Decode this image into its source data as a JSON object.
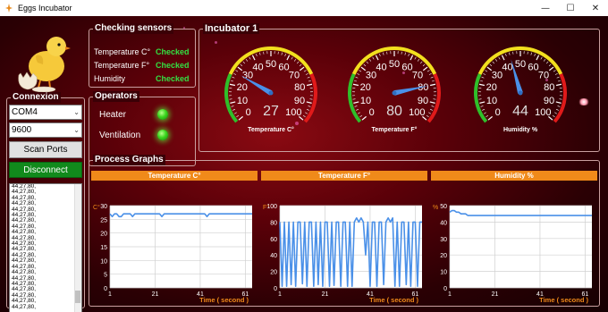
{
  "window": {
    "title": "Eggs Incubator",
    "minimize": "—",
    "maximize": "☐",
    "close": "✕"
  },
  "checking_sensors": {
    "title": "Checking sensors",
    "rows": [
      {
        "label": "Temperature C°",
        "status": "Checked"
      },
      {
        "label": "Temperature F°",
        "status": "Checked"
      },
      {
        "label": "Humidity",
        "status": "Checked"
      }
    ]
  },
  "operators": {
    "title": "Operators",
    "items": [
      {
        "label": "Heater",
        "state": "on"
      },
      {
        "label": "Ventilation",
        "state": "on"
      }
    ]
  },
  "connexion": {
    "title": "Connexion",
    "port": "COM4",
    "baud": "9600",
    "scan_label": "Scan Ports",
    "disconnect_label": "Disconnect",
    "log_lines": [
      "44,27,80,",
      "44,27,80,",
      "44,27,80,",
      "44,27,80,",
      "44,27,80,",
      "44,27,80,",
      "44,27,80,",
      "44,27,80,",
      "44,27,80,",
      "44,27,80,",
      "44,27,80,",
      "44,27,80,",
      "44,27,80,",
      "44,27,80,",
      "44,27,80,",
      "44,27,80,",
      "44,27,80,",
      "44,27,80,",
      "44,27,80,",
      "44,27,80,",
      "44,27,80,",
      "44,27,80,"
    ]
  },
  "incubator": {
    "title": "Incubator 1",
    "gauges": [
      {
        "label": "Temperature C°",
        "value": "27",
        "reading": 27,
        "min": 0,
        "max": 100,
        "ticks": [
          "0",
          "10",
          "20",
          "30",
          "40",
          "50",
          "60",
          "70",
          "80",
          "90",
          "100"
        ]
      },
      {
        "label": "Temperature F°",
        "value": "80",
        "reading": 80,
        "min": 0,
        "max": 100,
        "ticks": [
          "0",
          "10",
          "20",
          "30",
          "40",
          "50",
          "60",
          "70",
          "80",
          "90",
          "100"
        ]
      },
      {
        "label": "Humidity %",
        "value": "44",
        "reading": 44,
        "min": 0,
        "max": 100,
        "ticks": [
          "0",
          "10",
          "20",
          "30",
          "40",
          "50",
          "60",
          "70",
          "80",
          "90",
          "100"
        ]
      }
    ]
  },
  "process_graphs": {
    "title": "Process Graphs"
  },
  "colors": {
    "accent_orange": "#f08a1a",
    "line_blue": "#4a90e8",
    "ok_green": "#33e043"
  },
  "chart_data": [
    {
      "type": "line",
      "title": "Temperature C°",
      "ylabel": "C°",
      "xlabel": "Time ( second )",
      "x_ticks": [
        "1",
        "21",
        "41",
        "61"
      ],
      "y_ticks": [
        "0",
        "5",
        "10",
        "15",
        "20",
        "25",
        "30"
      ],
      "xlim": [
        1,
        64
      ],
      "ylim": [
        0,
        30
      ],
      "grid": true,
      "series": [
        {
          "values": [
            27,
            26,
            27,
            27,
            26,
            26,
            27,
            27,
            27,
            27,
            26,
            27,
            27,
            27,
            27,
            27,
            27,
            27,
            27,
            27,
            27,
            27,
            27,
            26,
            27,
            27,
            27,
            27,
            27,
            27,
            27,
            27,
            27,
            27,
            27,
            27,
            27,
            27,
            27,
            27,
            27,
            27,
            27,
            26,
            27,
            27,
            27,
            27,
            27,
            27,
            27,
            27,
            27,
            27,
            27,
            27,
            27,
            27,
            27,
            27,
            27,
            27,
            27,
            27
          ]
        }
      ]
    },
    {
      "type": "line",
      "title": "Temperature F°",
      "ylabel": "F°",
      "xlabel": "Time ( second )",
      "x_ticks": [
        "1",
        "21",
        "41",
        "61"
      ],
      "y_ticks": [
        "0",
        "20",
        "40",
        "60",
        "80",
        "100"
      ],
      "xlim": [
        1,
        64
      ],
      "ylim": [
        0,
        100
      ],
      "grid": true,
      "series": [
        {
          "values": [
            80,
            2,
            80,
            2,
            80,
            4,
            80,
            2,
            80,
            80,
            5,
            80,
            2,
            80,
            80,
            2,
            80,
            4,
            80,
            2,
            80,
            80,
            2,
            80,
            3,
            80,
            80,
            2,
            80,
            80,
            2,
            80,
            2,
            80,
            85,
            80,
            85,
            80,
            40,
            80,
            2,
            80,
            80,
            2,
            80,
            80,
            4,
            80,
            85,
            80,
            85,
            2,
            80,
            2,
            80,
            80,
            4,
            80,
            2,
            80,
            80,
            2,
            80,
            80
          ]
        }
      ]
    },
    {
      "type": "line",
      "title": "Humidity %",
      "ylabel": "%",
      "xlabel": "Time ( second )",
      "x_ticks": [
        "1",
        "21",
        "41",
        "61"
      ],
      "y_ticks": [
        "0",
        "10",
        "20",
        "30",
        "40",
        "50"
      ],
      "xlim": [
        1,
        64
      ],
      "ylim": [
        0,
        50
      ],
      "grid": true,
      "series": [
        {
          "values": [
            46,
            47,
            47,
            46,
            46,
            45,
            45,
            45,
            44,
            44,
            44,
            44,
            44,
            44,
            44,
            44,
            44,
            44,
            44,
            44,
            44,
            44,
            44,
            44,
            44,
            44,
            44,
            44,
            44,
            44,
            44,
            44,
            44,
            44,
            44,
            44,
            44,
            44,
            44,
            44,
            44,
            44,
            44,
            44,
            44,
            44,
            44,
            44,
            44,
            44,
            44,
            44,
            44,
            44,
            44,
            44,
            44,
            44,
            44,
            44,
            44,
            44,
            44,
            44
          ]
        }
      ]
    }
  ]
}
